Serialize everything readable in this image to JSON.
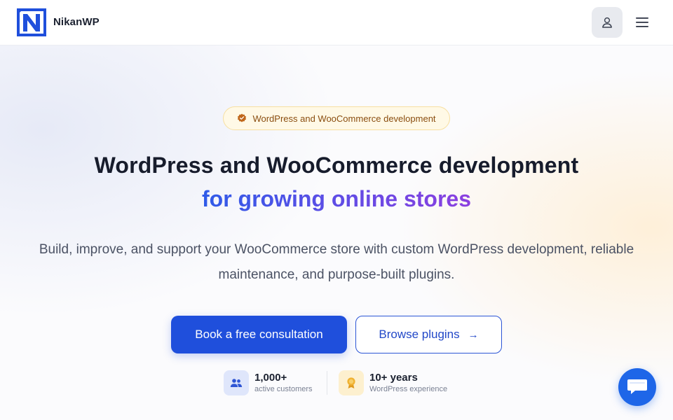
{
  "header": {
    "brand": "NikanWP",
    "account_icon": "user-icon",
    "menu_icon": "hamburger-menu-icon"
  },
  "hero": {
    "badge": "WordPress and WooCommerce development",
    "title_line1": "WordPress and WooCommerce development",
    "title_line2": "for growing online stores",
    "subtitle_line1": "Build, improve, and support your WooCommerce store with custom WordPress development, reliable",
    "subtitle_line2": "maintenance, and purpose-built plugins.",
    "primary_button": "Book a free consultation",
    "secondary_button": "Browse plugins",
    "secondary_arrow": "→"
  },
  "stats": [
    {
      "number": "1,000+",
      "label": "active customers",
      "icon": "users-icon"
    },
    {
      "number": "10+ years",
      "label": "WordPress experience",
      "icon": "award-icon"
    }
  ],
  "colors": {
    "primary": "#1f4fdc",
    "gradient_start": "#2f5be8",
    "gradient_end": "#8b3fe0",
    "badge_text": "#8a4d0f",
    "chat": "#1e66e8"
  },
  "chat": {
    "icon": "chat-bubble-icon"
  }
}
